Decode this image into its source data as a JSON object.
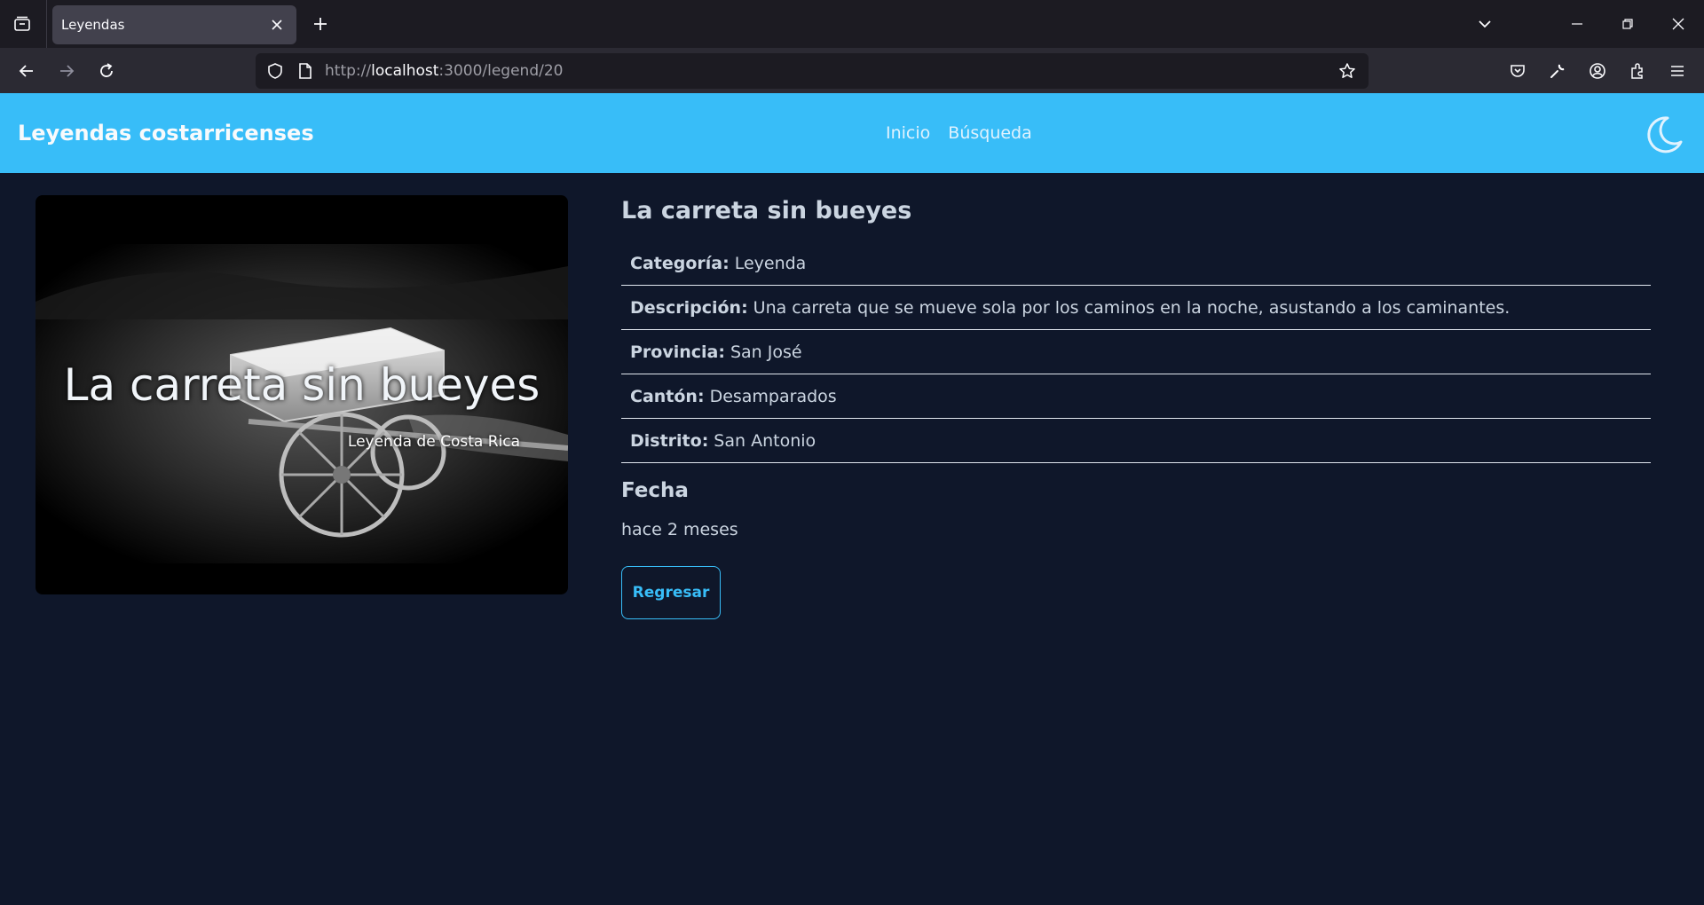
{
  "browser": {
    "tab_title": "Leyendas",
    "url_prefix": "http://",
    "url_host": "localhost",
    "url_rest": ":3000/legend/20"
  },
  "site": {
    "brand": "Leyendas costarricenses",
    "menu": [
      "Inicio",
      "Búsqueda"
    ],
    "accent": "#38bdf8",
    "background": "#0f172a"
  },
  "legend": {
    "image_title": "La carreta sin bueyes",
    "image_subtitle": "Leyenda de Costa Rica",
    "name": "La carreta sin bueyes",
    "fields": [
      {
        "label": "Categoría:",
        "value": "Leyenda"
      },
      {
        "label": "Descripción:",
        "value": "Una carreta que se mueve sola por los caminos en la noche, asustando a los caminantes."
      },
      {
        "label": "Provincia:",
        "value": "San José"
      },
      {
        "label": "Cantón:",
        "value": "Desamparados"
      },
      {
        "label": "Distrito:",
        "value": "San Antonio"
      }
    ],
    "date_heading": "Fecha",
    "date_value": "hace 2 meses",
    "back_label": "Regresar"
  }
}
